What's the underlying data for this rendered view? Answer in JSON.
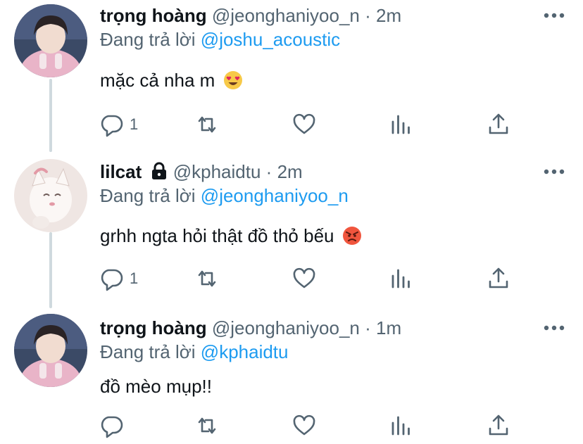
{
  "tweets": [
    {
      "name": "trọng hoàng",
      "handle": "@jeonghaniyoo_n",
      "dot": "·",
      "time": "2m",
      "replying_label": "Đang trả lời",
      "replying_to": "@joshu_acoustic",
      "text": "mặc cả nha m",
      "emoji": "heart-eyes-emoji",
      "reply_count": "1",
      "locked": false
    },
    {
      "name": "lilcat",
      "handle": "@kphaidtu",
      "dot": "·",
      "time": "2m",
      "replying_label": "Đang trả lời",
      "replying_to": "@jeonghaniyoo_n",
      "text": "grhh ngta hỏi thật đồ thỏ bếu",
      "emoji": "angry-face-emoji",
      "reply_count": "1",
      "locked": true
    },
    {
      "name": "trọng hoàng",
      "handle": "@jeonghaniyoo_n",
      "dot": "·",
      "time": "1m",
      "replying_label": "Đang trả lời",
      "replying_to": "@kphaidtu",
      "text": "đồ mèo mụp!!",
      "emoji": "",
      "reply_count": "",
      "locked": false
    }
  ],
  "icons": {
    "reply": "reply-icon",
    "retweet": "retweet-icon",
    "like": "heart-icon",
    "views": "analytics-icon",
    "share": "share-icon",
    "more": "more-dots-icon",
    "lock": "lock-icon"
  },
  "colors": {
    "text": "#0f1419",
    "secondary": "#536471",
    "link": "#1d9bf0",
    "thread_line": "#cfd9de"
  }
}
